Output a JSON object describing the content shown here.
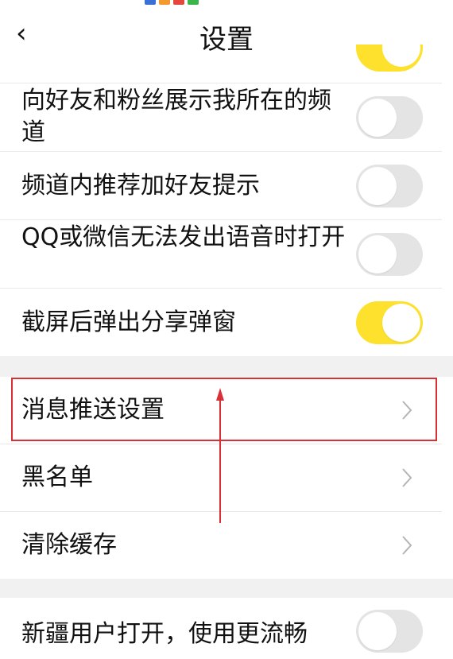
{
  "nav": {
    "title": "设置",
    "back_icon": "‹"
  },
  "toggles": [
    {
      "label": "向好友和粉丝展示我所在的频道",
      "on": false
    },
    {
      "label": "频道内推荐加好友提示",
      "on": false
    },
    {
      "label": "QQ或微信无法发出语音时打开",
      "on": false
    },
    {
      "label": "截屏后弹出分享弹窗",
      "on": true
    }
  ],
  "menu": [
    {
      "label": "消息推送设置"
    },
    {
      "label": "黑名单"
    },
    {
      "label": "清除缓存"
    }
  ],
  "bottom_toggle": {
    "label": "新疆用户打开，使用更流畅",
    "on": false
  },
  "colors": {
    "toggle_on": "#fde12d",
    "toggle_off": "#e4e4e4",
    "annotation": "#d93035"
  }
}
